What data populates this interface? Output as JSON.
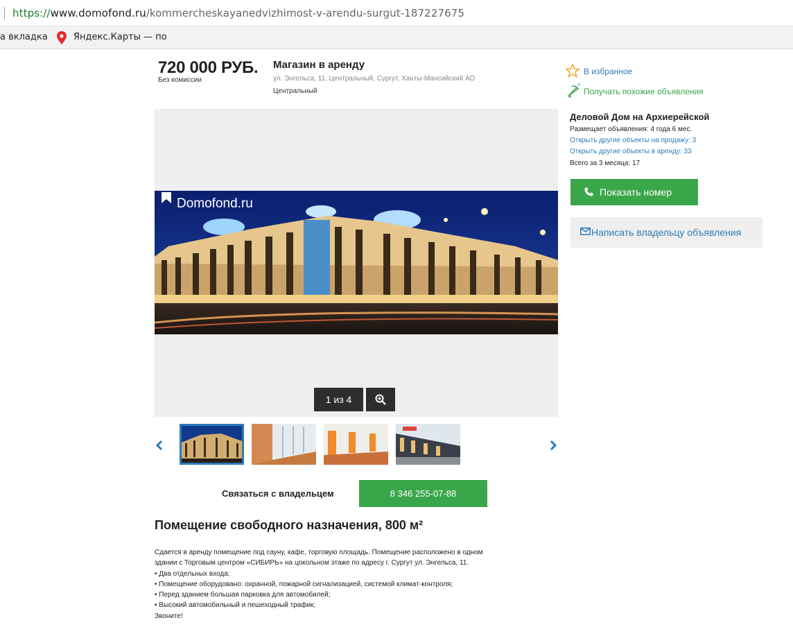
{
  "browser": {
    "url_scheme": "https://",
    "url_host": "www.domofond.ru",
    "url_path": "/kommercheskayanedvizhimost-v-arendu-surgut-187227675",
    "bookmarks": [
      {
        "label": "а вкладка"
      },
      {
        "label": "Яндекс.Карты — по",
        "icon": "yandex-maps-pin-icon"
      }
    ]
  },
  "listing": {
    "price": "720 000 РУБ.",
    "price_note": "Без комиссии",
    "title": "Магазин в аренду",
    "address": "ул. Энгельса, 11, Центральный, Сургут, Ханты-Мансийский АО",
    "district": "Центральный"
  },
  "gallery": {
    "watermark": "Domofond.ru",
    "counter": "1 из 4",
    "thumbnail_count": 4,
    "active_thumbnail": 1
  },
  "contact": {
    "label": "Связаться с владельцем",
    "phone": "8 346 255-07-88"
  },
  "description": {
    "title": "Помещение свободного назначения, 800 м²",
    "lines": [
      "Сдается в аренду помещение под сауну, кафе, торговую площадь. Помещение расположено в одном",
      "здании с Торговым центром «СИБИРЬ» на цокольном этаже по адресу г. Сургут ул. Энгельса, 11.",
      "• Два отдельных входа;",
      "• Помещение оборудовано: охранной, пожарной сигнализацией, системой климат-контроля;",
      "• Перед зданием большая парковка для автомобилей;",
      "• Высокий автомобильный и пешеходный трафик;",
      "Звоните!"
    ]
  },
  "sidebar": {
    "favorite": "В избранное",
    "similar": "Получать похожие объявления",
    "agent_name": "Деловой Дом на Архиерейской",
    "agent_since": "Размещает объявления: 4 года 6 мес.",
    "agent_sale_link": "Открыть другие объекты на продажу: 3",
    "agent_rent_link": "Открыть другие объекты в аренду: 33",
    "agent_total": "Всего за 3 месяца: 17",
    "show_number": "Показать номер",
    "write_owner": "Написать владельцу объявления"
  },
  "colors": {
    "accent_green": "#3aa64a",
    "link_blue": "#2b7bb9",
    "dark_overlay": "#2d2d2d",
    "star_orange": "#f0a830"
  }
}
